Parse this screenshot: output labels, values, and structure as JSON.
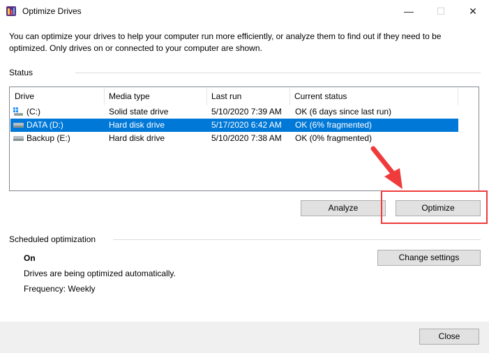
{
  "window": {
    "title": "Optimize Drives",
    "icon": "optimize-drives-icon",
    "controls": {
      "minimize": "—",
      "maximize": "☐",
      "close": "✕"
    }
  },
  "description": "You can optimize your drives to help your computer run more efficiently, or analyze them to find out if they need to be optimized. Only drives on or connected to your computer are shown.",
  "status": {
    "label": "Status",
    "columns": [
      "Drive",
      "Media type",
      "Last run",
      "Current status"
    ],
    "drives": [
      {
        "drive": "(C:)",
        "media_type": "Solid state drive",
        "last_run": "5/10/2020 7:39 AM",
        "current_status": "OK (6 days since last run)",
        "icon": "windows-drive-icon",
        "selected": false
      },
      {
        "drive": "DATA (D:)",
        "media_type": "Hard disk drive",
        "last_run": "5/17/2020 6:42 AM",
        "current_status": "OK (6% fragmented)",
        "icon": "hard-drive-icon",
        "selected": true
      },
      {
        "drive": "Backup (E:)",
        "media_type": "Hard disk drive",
        "last_run": "5/10/2020 7:38 AM",
        "current_status": "OK (0% fragmented)",
        "icon": "hard-drive-icon",
        "selected": false
      }
    ],
    "analyze_label": "Analyze",
    "optimize_label": "Optimize"
  },
  "scheduled": {
    "label": "Scheduled optimization",
    "state": "On",
    "message": "Drives are being optimized automatically.",
    "frequency": "Frequency: Weekly",
    "change_settings_label": "Change settings"
  },
  "footer": {
    "close_label": "Close"
  },
  "colors": {
    "selection": "#0078d7",
    "annotation": "#ef3b3b"
  }
}
